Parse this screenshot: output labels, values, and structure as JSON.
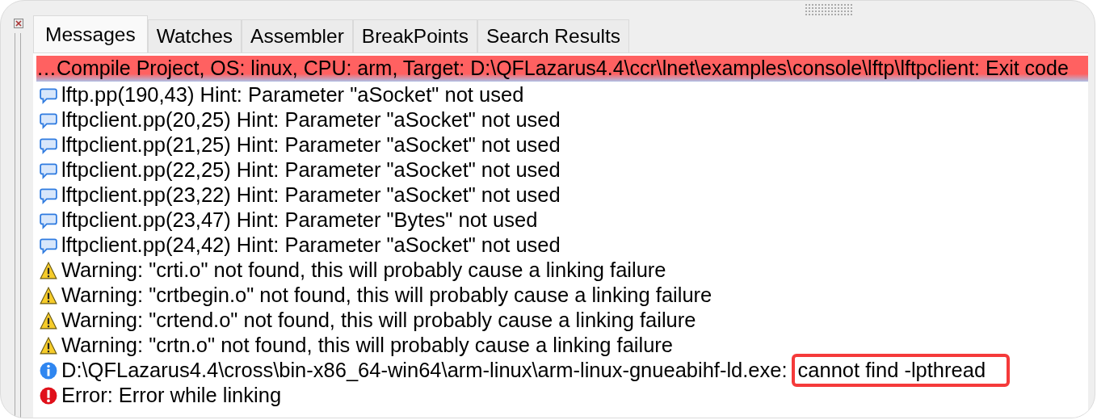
{
  "tabs": [
    {
      "label": "Messages",
      "selected": true
    },
    {
      "label": "Watches",
      "selected": false
    },
    {
      "label": "Assembler",
      "selected": false
    },
    {
      "label": "BreakPoints",
      "selected": false
    },
    {
      "label": "Search Results",
      "selected": false
    }
  ],
  "header": "…Compile Project, OS: linux, CPU: arm, Target: D:\\QFLazarus4.4\\ccr\\lnet\\examples\\console\\lftp\\lftpclient: Exit code",
  "messages": [
    {
      "kind": "hint",
      "text": "lftp.pp(190,43) Hint: Parameter \"aSocket\" not used"
    },
    {
      "kind": "hint",
      "text": "lftpclient.pp(20,25) Hint: Parameter \"aSocket\" not used"
    },
    {
      "kind": "hint",
      "text": "lftpclient.pp(21,25) Hint: Parameter \"aSocket\" not used"
    },
    {
      "kind": "hint",
      "text": "lftpclient.pp(22,25) Hint: Parameter \"aSocket\" not used"
    },
    {
      "kind": "hint",
      "text": "lftpclient.pp(23,22) Hint: Parameter \"aSocket\" not used"
    },
    {
      "kind": "hint",
      "text": "lftpclient.pp(23,47) Hint: Parameter \"Bytes\" not used"
    },
    {
      "kind": "hint",
      "text": "lftpclient.pp(24,42) Hint: Parameter \"aSocket\" not used"
    },
    {
      "kind": "warning",
      "text": "Warning: \"crti.o\" not found, this will probably cause a linking failure"
    },
    {
      "kind": "warning",
      "text": "Warning: \"crtbegin.o\" not found, this will probably cause a linking failure"
    },
    {
      "kind": "warning",
      "text": "Warning: \"crtend.o\" not found, this will probably cause a linking failure"
    },
    {
      "kind": "warning",
      "text": "Warning: \"crtn.o\" not found, this will probably cause a linking failure"
    },
    {
      "kind": "info",
      "text": "D:\\QFLazarus4.4\\cross\\bin-x86_64-win64\\arm-linux\\arm-linux-gnueabihf-ld.exe:",
      "highlight": "cannot find -lpthread"
    },
    {
      "kind": "error",
      "text": "Error: Error while linking"
    }
  ]
}
